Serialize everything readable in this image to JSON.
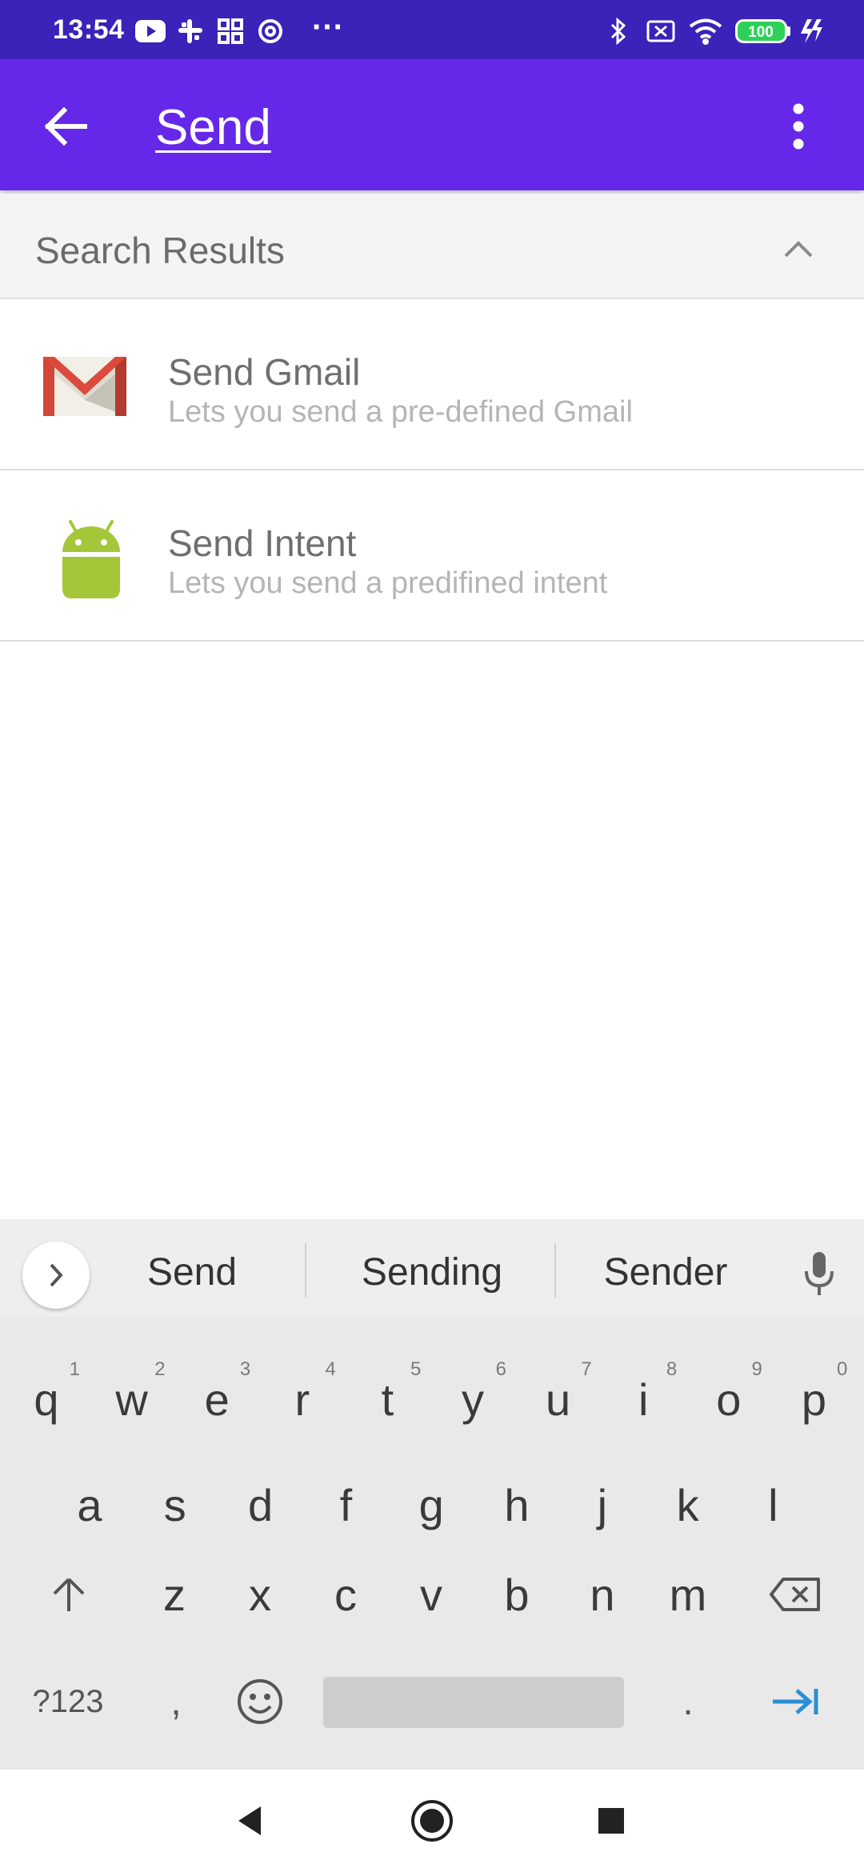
{
  "status_bar": {
    "time": "13:54",
    "left_icons": [
      "youtube-icon",
      "slack-icon",
      "grid-app-icon",
      "at-sign-icon"
    ],
    "overflow": "···",
    "right_icons": [
      "bluetooth-icon",
      "no-sim-icon",
      "wifi-icon",
      "battery-icon",
      "charging-icon"
    ],
    "battery_level": "100"
  },
  "app_bar": {
    "title": "Send",
    "back_icon": "arrow-left-icon",
    "menu_icon": "more-vert-icon"
  },
  "results": {
    "header": "Search Results",
    "collapse_icon": "chevron-up-icon",
    "items": [
      {
        "title": "Send Gmail",
        "subtitle": "Lets you send a pre-defined Gmail",
        "icon": "gmail-icon"
      },
      {
        "title": "Send Intent",
        "subtitle": "Lets you send a predifined intent",
        "icon": "android-icon"
      }
    ]
  },
  "keyboard": {
    "suggestions": [
      "Send",
      "Sending",
      "Sender"
    ],
    "row1": [
      {
        "k": "q",
        "h": "1"
      },
      {
        "k": "w",
        "h": "2"
      },
      {
        "k": "e",
        "h": "3"
      },
      {
        "k": "r",
        "h": "4"
      },
      {
        "k": "t",
        "h": "5"
      },
      {
        "k": "y",
        "h": "6"
      },
      {
        "k": "u",
        "h": "7"
      },
      {
        "k": "i",
        "h": "8"
      },
      {
        "k": "o",
        "h": "9"
      },
      {
        "k": "p",
        "h": "0"
      }
    ],
    "row2": [
      "a",
      "s",
      "d",
      "f",
      "g",
      "h",
      "j",
      "k",
      "l"
    ],
    "row3": [
      "z",
      "x",
      "c",
      "v",
      "b",
      "n",
      "m"
    ],
    "symbols_label": "?123",
    "comma": ",",
    "period": ".",
    "accent_color": "#2b8fd6"
  },
  "colors": {
    "status_bar": "#3b22b8",
    "app_bar": "#6628e8",
    "android_green": "#a4c639",
    "gmail_red": "#d44638"
  }
}
